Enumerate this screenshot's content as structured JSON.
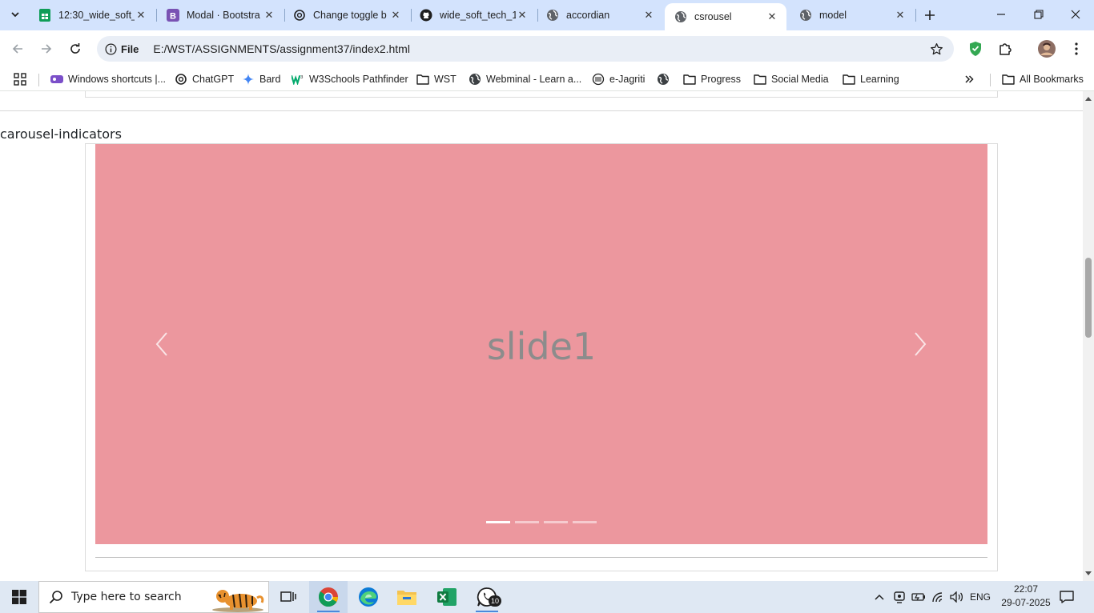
{
  "browser": {
    "tabs": [
      {
        "title": "12:30_wide_soft_",
        "favicon": "sheets-icon",
        "active": false
      },
      {
        "title": "Modal · Bootstra",
        "favicon": "bootstrap-icon",
        "active": false
      },
      {
        "title": "Change toggle b",
        "favicon": "chatgpt-icon",
        "active": false
      },
      {
        "title": "wide_soft_tech_1",
        "favicon": "github-icon",
        "active": false
      },
      {
        "title": "accordian",
        "favicon": "globe-icon",
        "active": false
      },
      {
        "title": "csrousel",
        "favicon": "globe-icon",
        "active": true
      },
      {
        "title": "model",
        "favicon": "globe-icon",
        "active": false
      }
    ],
    "address": {
      "scheme_label": "File",
      "url": "E:/WST/ASSIGNMENTS/assignment37/index2.html"
    },
    "bookmarks": [
      {
        "label": "Windows shortcuts |...",
        "icon": "windows-shortcuts-icon"
      },
      {
        "label": "ChatGPT",
        "icon": "chatgpt-icon"
      },
      {
        "label": "Bard",
        "icon": "bard-icon"
      },
      {
        "label": "W3Schools Pathfinder",
        "icon": "w3schools-icon"
      },
      {
        "label": "WST",
        "icon": "folder-icon"
      },
      {
        "label": "Webminal - Learn a...",
        "icon": "globe-icon"
      },
      {
        "label": "e-Jagriti",
        "icon": "ejagriti-icon"
      },
      {
        "label": "",
        "icon": "globe-icon"
      },
      {
        "label": "Progress",
        "icon": "folder-icon"
      },
      {
        "label": "Social Media",
        "icon": "folder-icon"
      },
      {
        "label": "Learning",
        "icon": "folder-icon"
      }
    ],
    "all_bookmarks_label": "All Bookmarks"
  },
  "page": {
    "section_label": "carousel-indicators",
    "carousel": {
      "caption": "slide1",
      "background": "#ec979e",
      "indicator_count": 4,
      "active_index": 0
    }
  },
  "taskbar": {
    "search_placeholder": "Type here to search",
    "whatsapp_badge": "10",
    "language": "ENG",
    "time": "22:07",
    "date": "29-07-2025"
  }
}
